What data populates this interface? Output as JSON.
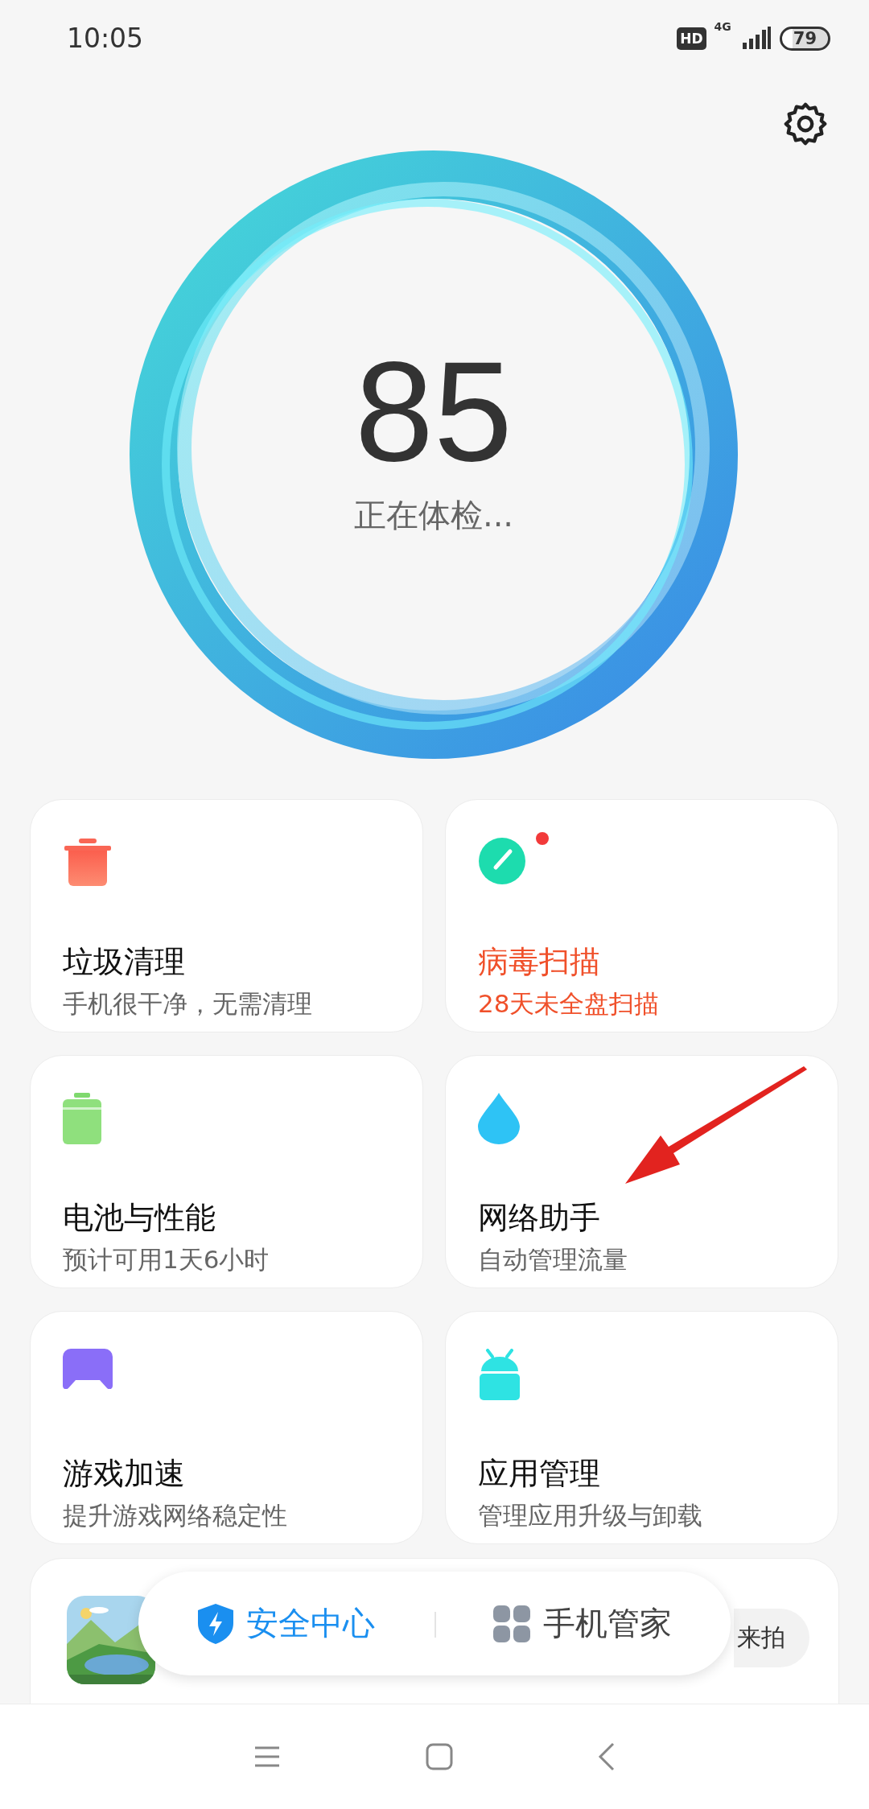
{
  "status_bar": {
    "time": "10:05",
    "hd": "HD",
    "network": "4G",
    "battery": "79"
  },
  "score": {
    "value": "85",
    "status": "正在体检..."
  },
  "tools": [
    {
      "kind": "trash",
      "title": "垃圾清理",
      "subtitle": "手机很干净，无需清理",
      "alert": false
    },
    {
      "kind": "scan",
      "title": "病毒扫描",
      "subtitle": "28天未全盘扫描",
      "alert": true
    },
    {
      "kind": "battery",
      "title": "电池与性能",
      "subtitle": "预计可用1天6小时",
      "alert": false
    },
    {
      "kind": "network",
      "title": "网络助手",
      "subtitle": "自动管理流量",
      "alert": false
    },
    {
      "kind": "game",
      "title": "游戏加速",
      "subtitle": "提升游戏网络稳定性",
      "alert": false
    },
    {
      "kind": "apps",
      "title": "应用管理",
      "subtitle": "管理应用升级与卸载",
      "alert": false
    }
  ],
  "promo": {
    "button": "来拍"
  },
  "bottom_tabs": [
    {
      "label": "安全中心",
      "selected": true
    },
    {
      "label": "手机管家",
      "selected": false
    }
  ]
}
